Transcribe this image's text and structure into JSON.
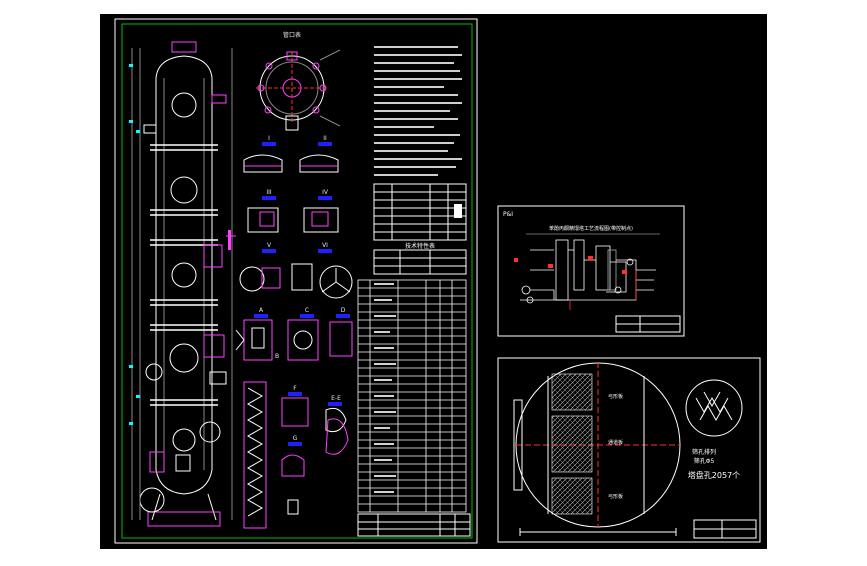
{
  "colors": {
    "background": "#ffffff",
    "canvas": "#000000",
    "frame": "#ffffff",
    "border_green": "#00c000",
    "magenta": "#ff40ff",
    "blue": "#2020ff",
    "cyan": "#00ffff",
    "red": "#ff3030",
    "yellow": "#ffff00"
  },
  "sheet_main": {
    "detail_titles": [
      "I",
      "II",
      "III",
      "IV",
      "V",
      "VI",
      "A",
      "B",
      "C",
      "D",
      "E-E",
      "F",
      "G"
    ],
    "table_labels": [
      "管口表",
      "技术特性表"
    ]
  },
  "sheet_flow": {
    "corner_label": "P&I",
    "title": "苯酚丙酮精馏塔工艺流程图(带控制点)"
  },
  "sheet_tray": {
    "section_labels": [
      "弓形板",
      "通道板",
      "弓形板"
    ],
    "hole_note": "筛孔排列",
    "hole_detail": "筛孔Φ5",
    "hole_count": "塔盘孔2057个"
  }
}
